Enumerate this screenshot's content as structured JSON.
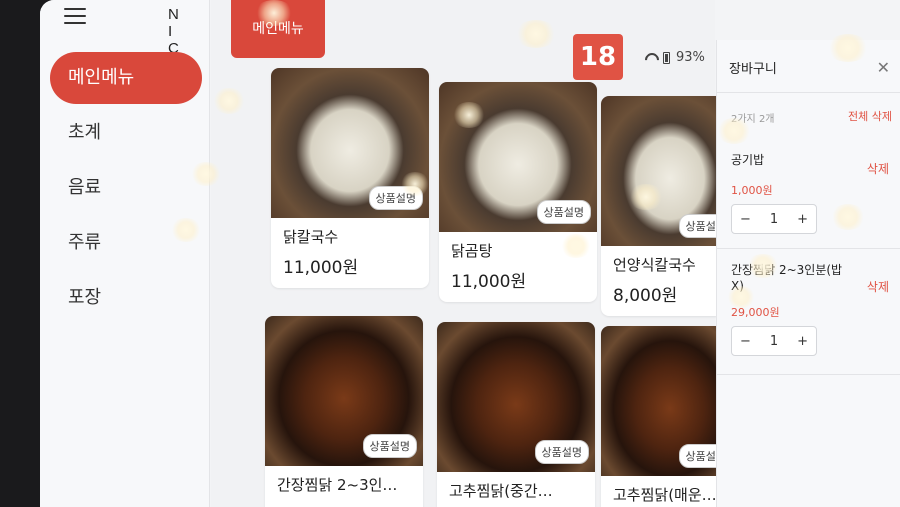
{
  "sidebar": {
    "logo": "NICE",
    "items": [
      {
        "label": "메인메뉴",
        "active": true
      },
      {
        "label": "초계",
        "active": false
      },
      {
        "label": "음료",
        "active": false
      },
      {
        "label": "주류",
        "active": false
      },
      {
        "label": "포장",
        "active": false
      }
    ]
  },
  "header": {
    "category_tab": "메인메뉴",
    "table_number": "18",
    "battery": "93%",
    "icons": [
      "wifi-icon",
      "battery-icon"
    ]
  },
  "menu": {
    "description_label": "상품설명",
    "items": [
      {
        "name": "닭칼국수",
        "price": "11,000원",
        "photo": "soup"
      },
      {
        "name": "닭곰탕",
        "price": "11,000원",
        "photo": "soup"
      },
      {
        "name": "언양식칼국수",
        "price": "8,000원",
        "photo": "soup"
      },
      {
        "name": "간장찜닭 2~3인…",
        "price": "",
        "photo": "stew"
      },
      {
        "name": "고추찜닭(중간…",
        "price": "",
        "photo": "stew"
      },
      {
        "name": "고추찜닭(매운…",
        "price": "",
        "photo": "stew"
      }
    ]
  },
  "cart": {
    "title": "장바구니",
    "close_icon": "close-icon",
    "count_text": "2가지 2개",
    "clear_all": "전체 삭제",
    "items": [
      {
        "name": "공기밥",
        "price": "1,000원",
        "qty": "1",
        "delete": "삭제"
      },
      {
        "name": "간장찜닭 2~3인분(밥 X)",
        "price": "29,000원",
        "qty": "1",
        "delete": "삭제"
      }
    ],
    "minus": "−",
    "plus": "+"
  },
  "colors": {
    "accent": "#d9483b",
    "badge": "#e05344"
  }
}
